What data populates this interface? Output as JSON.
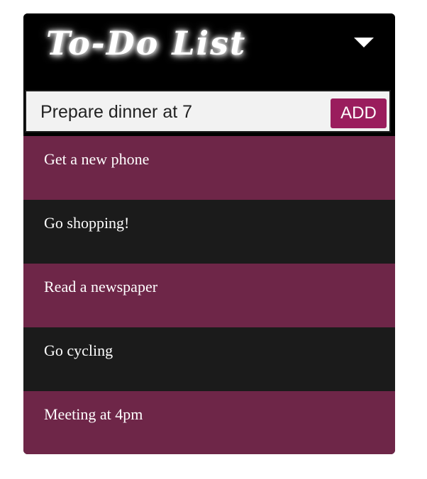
{
  "header": {
    "title": "To-Do List",
    "toggle_icon": "caret-down-icon"
  },
  "new_task": {
    "value": "Prepare dinner at 7",
    "placeholder": "",
    "add_label": "ADD"
  },
  "tasks": [
    {
      "text": "Get a new phone"
    },
    {
      "text": "Go shopping!"
    },
    {
      "text": "Read a newspaper"
    },
    {
      "text": "Go cycling"
    },
    {
      "text": "Meeting at 4pm"
    }
  ],
  "colors": {
    "header_bg": "#000000",
    "accent": "#9a1d5d",
    "row_odd": "#6e2648",
    "row_even": "#1b1b1b",
    "input_bg": "#f2f2f2"
  }
}
